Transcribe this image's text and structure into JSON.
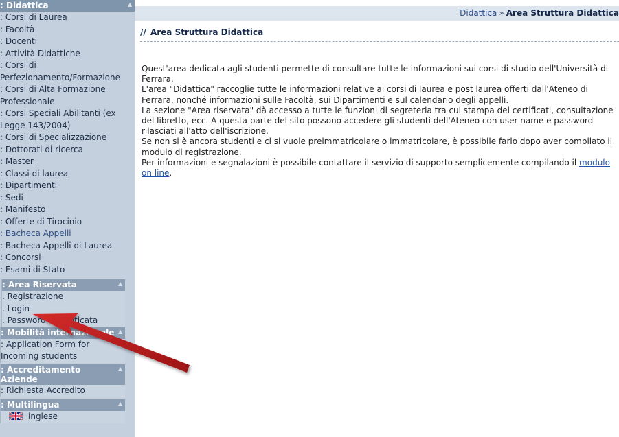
{
  "sidebar": {
    "didattica": {
      "title": ": Didattica",
      "items": [
        ": Corsi di Laurea",
        ": Facoltà",
        ": Docenti",
        ": Attività Didattiche",
        ": Corsi di Perfezionamento/Formazione",
        ": Corsi di Alta Formazione Professionale",
        ": Corsi Speciali Abilitanti (ex Legge 143/2004)",
        ": Corsi di Specializzazione",
        ": Dottorati di ricerca",
        ": Master",
        ": Classi di laurea",
        ": Dipartimenti",
        ": Sedi",
        ": Manifesto",
        ": Offerte di Tirocinio",
        ": Bacheca Appelli",
        ": Bacheca Appelli di Laurea",
        ": Concorsi",
        ": Esami di Stato"
      ]
    },
    "area_riservata": {
      "title": ": Area Riservata",
      "items": [
        ". Registrazione",
        ". Login",
        ". Password dimenticata"
      ]
    },
    "mobilita": {
      "title": ": Mobilità internazionale",
      "items": [
        ": Application Form for Incoming students"
      ]
    },
    "accreditamento": {
      "title": ": Accreditamento Aziende",
      "items": [
        ": Richiesta Accredito"
      ]
    },
    "multilingua": {
      "title": ": Multilingua",
      "items": [
        "inglese"
      ]
    }
  },
  "breadcrumb": {
    "link": "Didattica",
    "separator": "»",
    "current": "Area Struttura Didattica"
  },
  "page": {
    "title_prefix": "//",
    "title": "Area Struttura Didattica",
    "paragraphs": [
      "Quest'area dedicata agli studenti permette di consultare tutte le informazioni sui corsi di studio dell'Università di Ferrara.",
      "L'area \"Didattica\" raccoglie tutte le informazioni relative ai corsi di laurea e post laurea offerti dall'Ateneo di Ferrara, nonché informazioni sulle Facoltà, sui Dipartimenti e sul calendario degli appelli.",
      "La sezione \"Area riservata\" dà accesso a tutte le funzioni di segreteria tra cui stampa dei certificati, consultazione del libretto, ecc. A questa parte del sito possono accedere gli studenti dell'Ateneo con user name e password rilasciati all'atto dell'iscrizione.",
      "Se non si è ancora studenti e ci si vuole preimmatricolare o immatricolare, è possibile farlo dopo aver compilato il modulo di registrazione."
    ],
    "support_text": "Per informazioni e segnalazioni è possibile contattare il servizio di supporto semplicemente compilando il ",
    "support_link": "modulo on line",
    "support_end": "."
  },
  "colors": {
    "sidebar_bg": "#c4d0de",
    "section_header": "#7f95ac",
    "breadcrumb_bg": "#dde6ef",
    "link": "#2054a8",
    "arrow": "#b31b1b"
  }
}
